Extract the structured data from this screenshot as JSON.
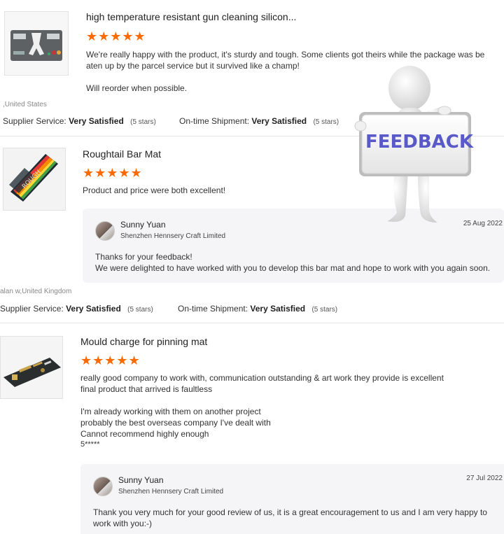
{
  "reviews": [
    {
      "title": "high temperature resistant gun cleaning silicon...",
      "stars": "★★★★★",
      "body": [
        "We're really happy with the product, it's sturdy and tough. Some clients got theirs while the package was be",
        "aten up by the parcel service but it survived like a champ!",
        "",
        "Will reorder when possible."
      ],
      "reviewer": ",United States",
      "supplier_label": "Supplier Service:",
      "supplier_value": "Very Satisfied",
      "supplier_stars": "(5 stars)",
      "shipment_label": "On-time Shipment:",
      "shipment_value": "Very Satisfied",
      "shipment_stars": "(5 stars)"
    },
    {
      "title": "Roughtail Bar Mat",
      "stars": "★★★★★",
      "body": [
        "Product and price were both excellent!"
      ],
      "reply": {
        "name": "Sunny Yuan",
        "company": "Shenzhen Hennsery Craft Limited",
        "date": "25 Aug 2022",
        "text": [
          "Thanks for your feedback!",
          "We were delighted to have worked with you to develop this bar mat and hope to work with you again soon."
        ]
      },
      "reviewer": "alan w,United Kingdom",
      "supplier_label": "Supplier Service:",
      "supplier_value": "Very Satisfied",
      "supplier_stars": "(5 stars)",
      "shipment_label": "On-time Shipment:",
      "shipment_value": "Very Satisfied",
      "shipment_stars": "(5 stars)"
    },
    {
      "title": "Mould charge for pinning mat",
      "stars": "★★★★★",
      "body": [
        "really good company to work with, communication outstanding & art work they provide is excellent",
        "final product that arrived is faultless",
        "",
        "I'm already working with them on another project",
        "probably the best overseas company I've dealt with",
        "Cannot recommend highly enough",
        "5*****"
      ],
      "reply": {
        "name": "Sunny Yuan",
        "company": "Shenzhen Hennsery Craft Limited",
        "date": "27 Jul 2022",
        "text": [
          "Thank you very much for your good review of us, it is a great encouragement to us and I am very happy to",
          "work with you:-)"
        ]
      }
    }
  ],
  "overlay": {
    "label": "FEEDBACK"
  },
  "colors": {
    "star": "#ff6a00",
    "feedback_text": "#5959c8",
    "reply_bg": "#f5f5f7"
  }
}
